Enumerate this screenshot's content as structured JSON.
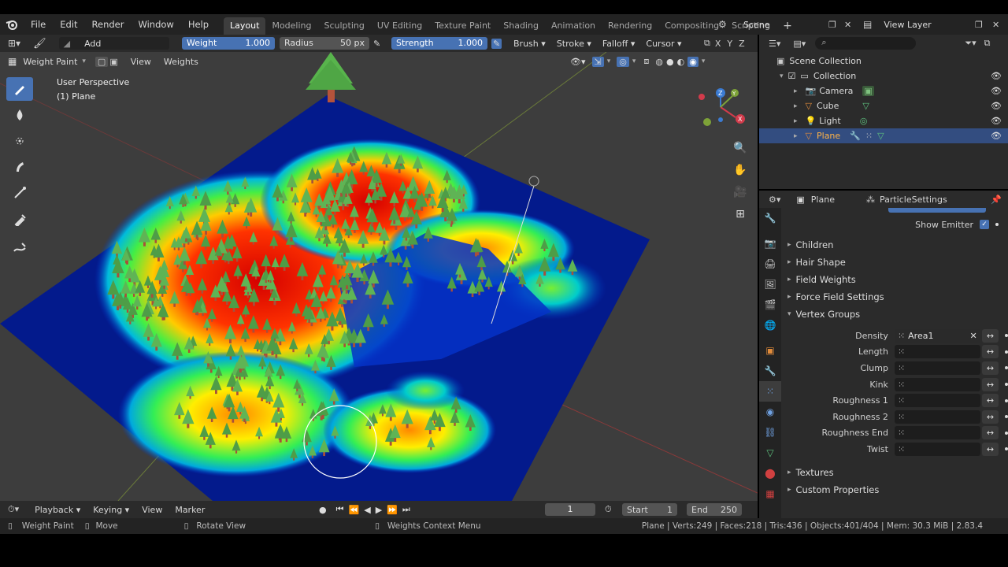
{
  "menu": [
    "File",
    "Edit",
    "Render",
    "Window",
    "Help"
  ],
  "workspaces": [
    "Layout",
    "Modeling",
    "Sculpting",
    "UV Editing",
    "Texture Paint",
    "Shading",
    "Animation",
    "Rendering",
    "Compositing",
    "Scripting"
  ],
  "active_workspace": "Layout",
  "scene_name": "Scene",
  "view_layer": "View Layer",
  "tool_header": {
    "blend_mode": "Add",
    "weight_label": "Weight",
    "weight_value": "1.000",
    "radius_label": "Radius",
    "radius_value": "50 px",
    "strength_label": "Strength",
    "strength_value": "1.000",
    "brush": "Brush",
    "stroke": "Stroke",
    "falloff": "Falloff",
    "cursor": "Cursor",
    "x": "X",
    "y": "Y",
    "z": "Z"
  },
  "viewport_header": {
    "mode": "Weight Paint",
    "view": "View",
    "weights": "Weights"
  },
  "viewport_overlay": {
    "perspective": "User Perspective",
    "object": "(1) Plane"
  },
  "outliner": {
    "root": "Scene Collection",
    "collection": "Collection",
    "items": [
      "Camera",
      "Cube",
      "Light",
      "Plane"
    ],
    "selected": "Plane"
  },
  "properties": {
    "object_tab": "Plane",
    "settings_tab": "ParticleSettings",
    "show_emitter": "Show Emitter",
    "panels_collapsed": [
      "Children",
      "Hair Shape",
      "Field Weights",
      "Force Field Settings"
    ],
    "vertex_groups_panel": "Vertex Groups",
    "vertex_groups": [
      {
        "label": "Density",
        "value": "Area1"
      },
      {
        "label": "Length",
        "value": ""
      },
      {
        "label": "Clump",
        "value": ""
      },
      {
        "label": "Kink",
        "value": ""
      },
      {
        "label": "Roughness 1",
        "value": ""
      },
      {
        "label": "Roughness 2",
        "value": ""
      },
      {
        "label": "Roughness End",
        "value": ""
      },
      {
        "label": "Twist",
        "value": ""
      }
    ],
    "panels_bottom": [
      "Textures",
      "Custom Properties"
    ]
  },
  "timeline": {
    "playback": "Playback",
    "keying": "Keying",
    "view": "View",
    "marker": "Marker",
    "current_frame": "1",
    "start_label": "Start",
    "start_value": "1",
    "end_label": "End",
    "end_value": "250"
  },
  "statusbar": {
    "left1": "Weight Paint",
    "left2": "Move",
    "left3": "Rotate View",
    "middle": "Weights Context Menu",
    "stats": "Plane | Verts:249 | Faces:218 | Tris:436 | Objects:401/404 | Mem: 30.3 MiB | 2.83.4"
  },
  "colors": {
    "accent": "#4772b3",
    "selected_row": "#334d80",
    "bg_dark": "#232323",
    "panel": "#2b2b2b",
    "viewport": "#3d3d3d"
  }
}
